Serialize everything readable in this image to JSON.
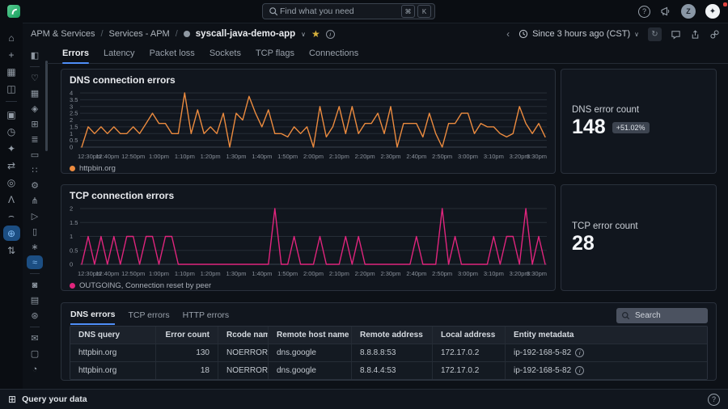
{
  "topbar": {
    "search_placeholder": "Find what you need",
    "avatar_initial": "Z"
  },
  "icons": {
    "key_cmd": "⌘",
    "key_k": "K",
    "help": "?",
    "assistant": "✦",
    "back": "‹",
    "chevron_down": "∨",
    "refresh": "↻",
    "info": "i",
    "star": "★",
    "footer_query": "⊞"
  },
  "header": {
    "breadcrumb_1": "APM & Services",
    "breadcrumb_2": "Services - APM",
    "separator": "/",
    "entity": "syscall-java-demo-app",
    "time_range": "Since 3 hours ago (CST)"
  },
  "outer_rail": {
    "items": [
      {
        "name": "home-icon",
        "glyph": "⌂"
      },
      {
        "name": "plus-icon",
        "glyph": "+"
      },
      {
        "name": "apps-grid-icon",
        "glyph": "▦"
      },
      {
        "name": "docs-book-icon",
        "glyph": "◫"
      },
      {
        "type": "divider"
      },
      {
        "name": "observe-app-icon",
        "glyph": "▣"
      },
      {
        "name": "dashboards-app-icon",
        "glyph": "◷"
      },
      {
        "name": "ai-sparkle-icon",
        "glyph": "✦"
      },
      {
        "name": "workflows-app-icon",
        "glyph": "⇄"
      },
      {
        "name": "profile-app-icon",
        "glyph": "◎"
      },
      {
        "name": "logs-app-icon",
        "glyph": "Λ"
      },
      {
        "name": "academy-app-icon",
        "glyph": "⌢"
      },
      {
        "name": "globe-app-icon",
        "glyph": "⊕",
        "selected": true
      },
      {
        "name": "sliders-icon",
        "glyph": "⇅"
      }
    ]
  },
  "inner_rail": {
    "items": [
      {
        "name": "collapse-panel-icon",
        "glyph": "◧"
      },
      {
        "type": "divider"
      },
      {
        "name": "feedback-thumbs-icon",
        "glyph": "♡"
      },
      {
        "name": "gallery-icon",
        "glyph": "▦"
      },
      {
        "name": "shield-icon",
        "glyph": "◈"
      },
      {
        "name": "cards-icon",
        "glyph": "⊞"
      },
      {
        "name": "filter-list-icon",
        "glyph": "≣"
      },
      {
        "name": "device-icon",
        "glyph": "▭"
      },
      {
        "name": "nodes-icon",
        "glyph": "∷"
      },
      {
        "name": "gear-icon",
        "glyph": "⚙"
      },
      {
        "name": "topology-icon",
        "glyph": "⋔"
      },
      {
        "name": "send-icon",
        "glyph": "▷"
      },
      {
        "name": "monitor-icon",
        "glyph": "▯"
      },
      {
        "name": "asterisk-icon",
        "glyph": "∗"
      },
      {
        "name": "syscall-chart-icon",
        "glyph": "≈",
        "selected": true
      },
      {
        "type": "divider"
      },
      {
        "name": "capture-icon",
        "glyph": "◙"
      },
      {
        "name": "building-icon",
        "glyph": "▤"
      },
      {
        "name": "settings-icon",
        "glyph": "⊛"
      },
      {
        "type": "divider"
      },
      {
        "name": "mail-icon",
        "glyph": "✉"
      },
      {
        "name": "document-icon",
        "glyph": "▢"
      },
      {
        "name": "help-circle-icon",
        "glyph": "◔"
      }
    ]
  },
  "tabs": {
    "items": [
      {
        "label": "Errors",
        "active": true
      },
      {
        "label": "Latency"
      },
      {
        "label": "Packet loss"
      },
      {
        "label": "Sockets"
      },
      {
        "label": "TCP flags"
      },
      {
        "label": "Connections"
      }
    ]
  },
  "dns_count": {
    "label": "DNS error count",
    "value": "148",
    "delta": "+51.02%"
  },
  "tcp_count": {
    "label": "TCP error count",
    "value": "28"
  },
  "table": {
    "tabs": [
      {
        "label": "DNS errors",
        "active": true
      },
      {
        "label": "TCP errors"
      },
      {
        "label": "HTTP errors"
      }
    ],
    "search_placeholder": "Search",
    "columns": [
      "DNS query",
      "Error count",
      "Rcode name",
      "Remote host name",
      "Remote address",
      "Local address",
      "Entity metadata"
    ],
    "numeric_columns": [
      1
    ],
    "rows": [
      [
        "httpbin.org",
        "130",
        "NOERROR",
        "dns.google",
        "8.8.8.8:53",
        "172.17.0.2",
        "ip-192-168-5-82"
      ],
      [
        "httpbin.org",
        "18",
        "NOERROR",
        "dns.google",
        "8.8.4.4:53",
        "172.17.0.2",
        "ip-192-168-5-82"
      ]
    ]
  },
  "footer": {
    "label": "Query your data"
  },
  "chart_data": [
    {
      "type": "line",
      "title": "DNS connection errors",
      "ylim": [
        0,
        4
      ],
      "y_ticks": [
        0,
        0.5,
        1,
        1.5,
        2,
        2.5,
        3,
        3.5,
        4
      ],
      "x_tick_labels": [
        "12:30pm",
        "12:40pm",
        "12:50pm",
        "1:00pm",
        "1:10pm",
        "1:20pm",
        "1:30pm",
        "1:40pm",
        "1:50pm",
        "2:00pm",
        "2:10pm",
        "2:20pm",
        "2:30pm",
        "2:40pm",
        "2:50pm",
        "3:00pm",
        "3:10pm",
        "3:20pm",
        "3:30pm"
      ],
      "interval_minutes": 2.5,
      "grid": true,
      "legend_position": "bottom-left",
      "series": [
        {
          "name": "httpbin.org",
          "color": "#ec8b3f",
          "values": [
            0,
            1.5,
            1,
            1.5,
            1,
            1.5,
            1,
            1,
            1.5,
            1,
            1.75,
            2.5,
            1.75,
            1.75,
            1,
            1,
            4,
            1,
            2.75,
            1,
            1.5,
            1,
            2.5,
            0,
            2.5,
            2,
            3.75,
            2.5,
            1.5,
            2.75,
            1,
            1,
            0.75,
            1.5,
            1,
            1.5,
            0,
            3,
            0.75,
            1.5,
            3,
            1,
            3,
            1,
            1.75,
            1.75,
            2.5,
            1,
            3,
            0,
            1.75,
            1.75,
            1.75,
            0.75,
            2.5,
            1,
            0,
            1.75,
            1.75,
            2.5,
            2.5,
            1,
            1.75,
            1.5,
            1.5,
            1,
            0.75,
            1,
            3,
            1.75,
            1,
            1.75,
            0.75
          ]
        }
      ]
    },
    {
      "type": "line",
      "title": "TCP connection errors",
      "ylim": [
        0,
        2
      ],
      "y_ticks": [
        0,
        0.5,
        1,
        1.5,
        2
      ],
      "x_tick_labels": [
        "12:30pm",
        "12:40pm",
        "12:50pm",
        "1:00pm",
        "1:10pm",
        "1:20pm",
        "1:30pm",
        "1:40pm",
        "1:50pm",
        "2:00pm",
        "2:10pm",
        "2:20pm",
        "2:30pm",
        "2:40pm",
        "2:50pm",
        "3:00pm",
        "3:10pm",
        "3:20pm",
        "3:30pm"
      ],
      "interval_minutes": 2.5,
      "grid": true,
      "legend_position": "bottom-left",
      "series": [
        {
          "name": "OUTGOING, Connection reset by peer",
          "color": "#e0257d",
          "values": [
            0,
            1,
            0,
            1,
            0,
            1,
            0,
            1,
            1,
            0,
            1,
            1,
            0,
            1,
            1,
            0,
            0,
            0,
            0,
            0,
            0,
            0,
            0,
            0,
            0,
            0,
            0,
            0,
            0,
            0,
            2,
            0,
            0,
            1,
            0,
            0,
            0,
            1,
            0,
            0,
            0,
            1,
            0,
            1,
            0,
            0,
            0,
            0,
            0,
            0,
            0,
            0,
            1,
            0,
            0,
            0,
            2,
            0,
            1,
            0,
            0,
            0,
            0,
            0,
            1,
            0,
            1,
            1,
            0,
            2,
            0,
            1,
            0
          ]
        }
      ]
    }
  ]
}
